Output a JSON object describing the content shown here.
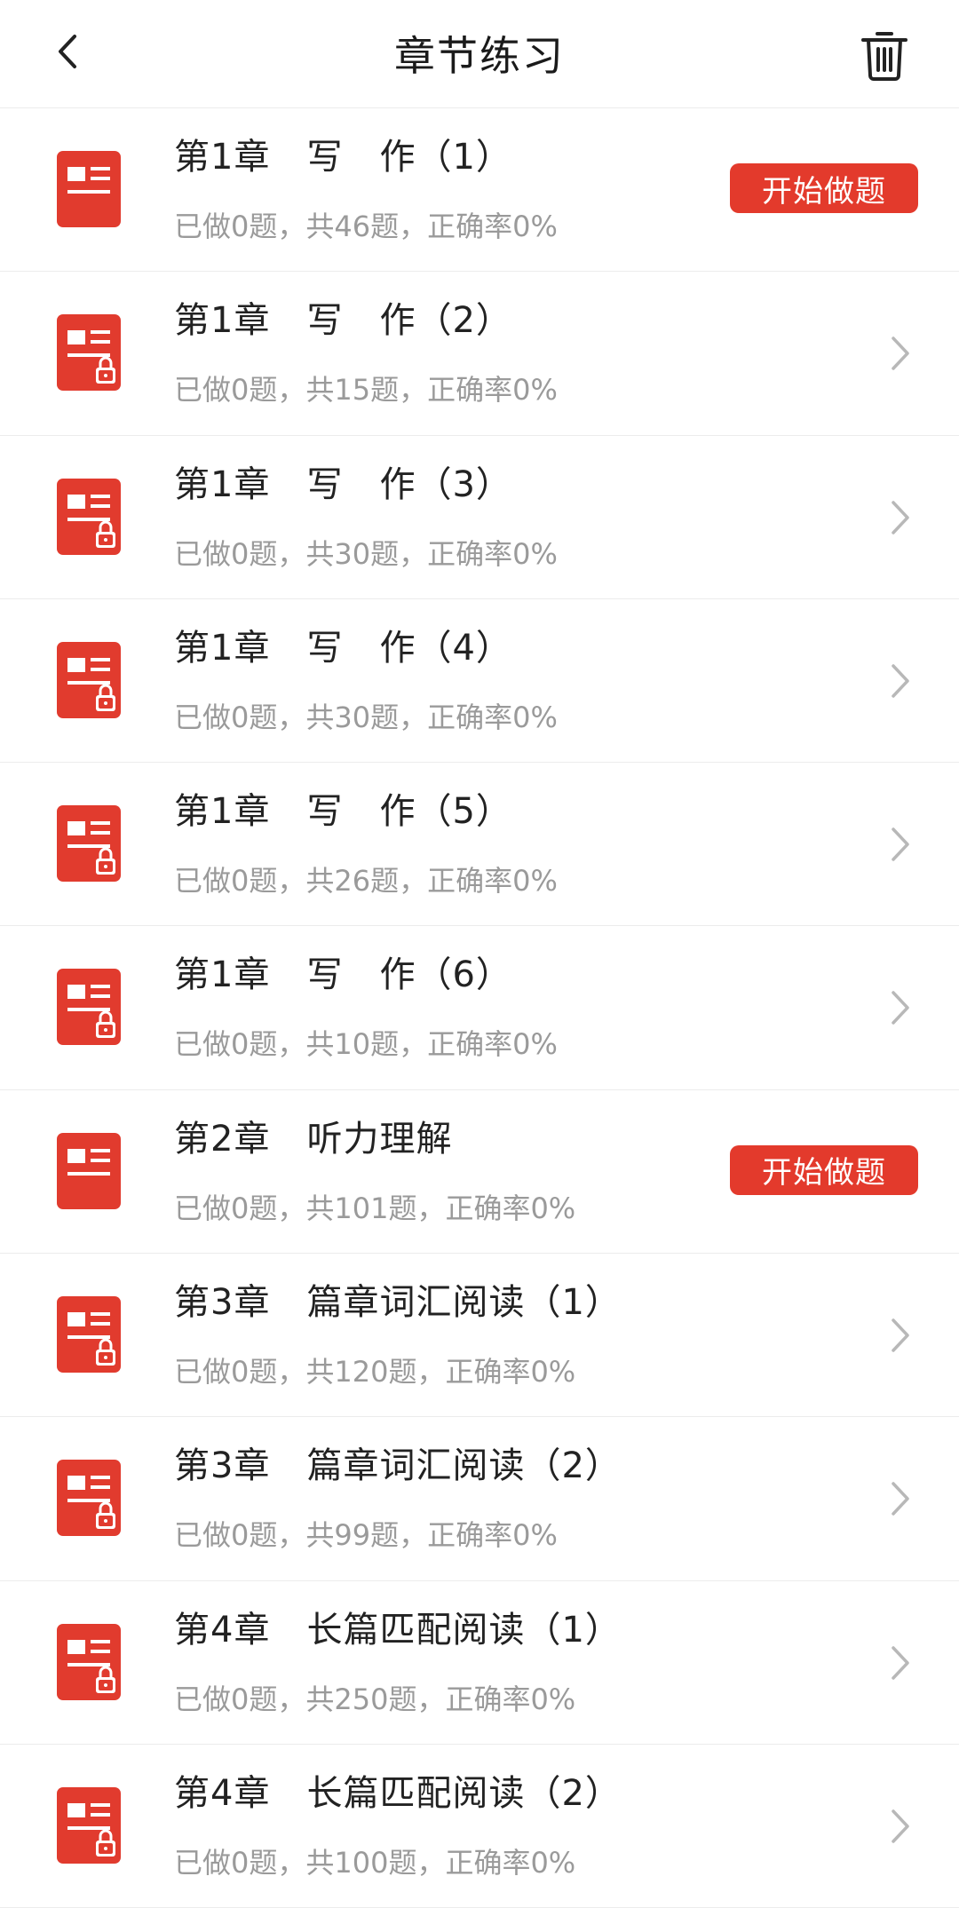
{
  "header": {
    "title": "章节练习",
    "back_icon": "chevron-left-icon",
    "trash_icon": "trash-icon"
  },
  "colors": {
    "accent": "#e33a2c",
    "icon_red": "#e13b2e",
    "subtext": "#9a9a9a",
    "divider": "#ececec"
  },
  "items": [
    {
      "title": "第1章　写　作（1）",
      "subtitle": "已做0题，共46题，正确率0%",
      "locked": false,
      "action": "开始做题"
    },
    {
      "title": "第1章　写　作（2）",
      "subtitle": "已做0题，共15题，正确率0%",
      "locked": true,
      "action": ""
    },
    {
      "title": "第1章　写　作（3）",
      "subtitle": "已做0题，共30题，正确率0%",
      "locked": true,
      "action": ""
    },
    {
      "title": "第1章　写　作（4）",
      "subtitle": "已做0题，共30题，正确率0%",
      "locked": true,
      "action": ""
    },
    {
      "title": "第1章　写　作（5）",
      "subtitle": "已做0题，共26题，正确率0%",
      "locked": true,
      "action": ""
    },
    {
      "title": "第1章　写　作（6）",
      "subtitle": "已做0题，共10题，正确率0%",
      "locked": true,
      "action": ""
    },
    {
      "title": "第2章　听力理解",
      "subtitle": "已做0题，共101题，正确率0%",
      "locked": false,
      "action": "开始做题"
    },
    {
      "title": "第3章　篇章词汇阅读（1）",
      "subtitle": "已做0题，共120题，正确率0%",
      "locked": true,
      "action": ""
    },
    {
      "title": "第3章　篇章词汇阅读（2）",
      "subtitle": "已做0题，共99题，正确率0%",
      "locked": true,
      "action": ""
    },
    {
      "title": "第4章　长篇匹配阅读（1）",
      "subtitle": "已做0题，共250题，正确率0%",
      "locked": true,
      "action": ""
    },
    {
      "title": "第4章　长篇匹配阅读（2）",
      "subtitle": "已做0题，共100题，正确率0%",
      "locked": true,
      "action": ""
    }
  ]
}
